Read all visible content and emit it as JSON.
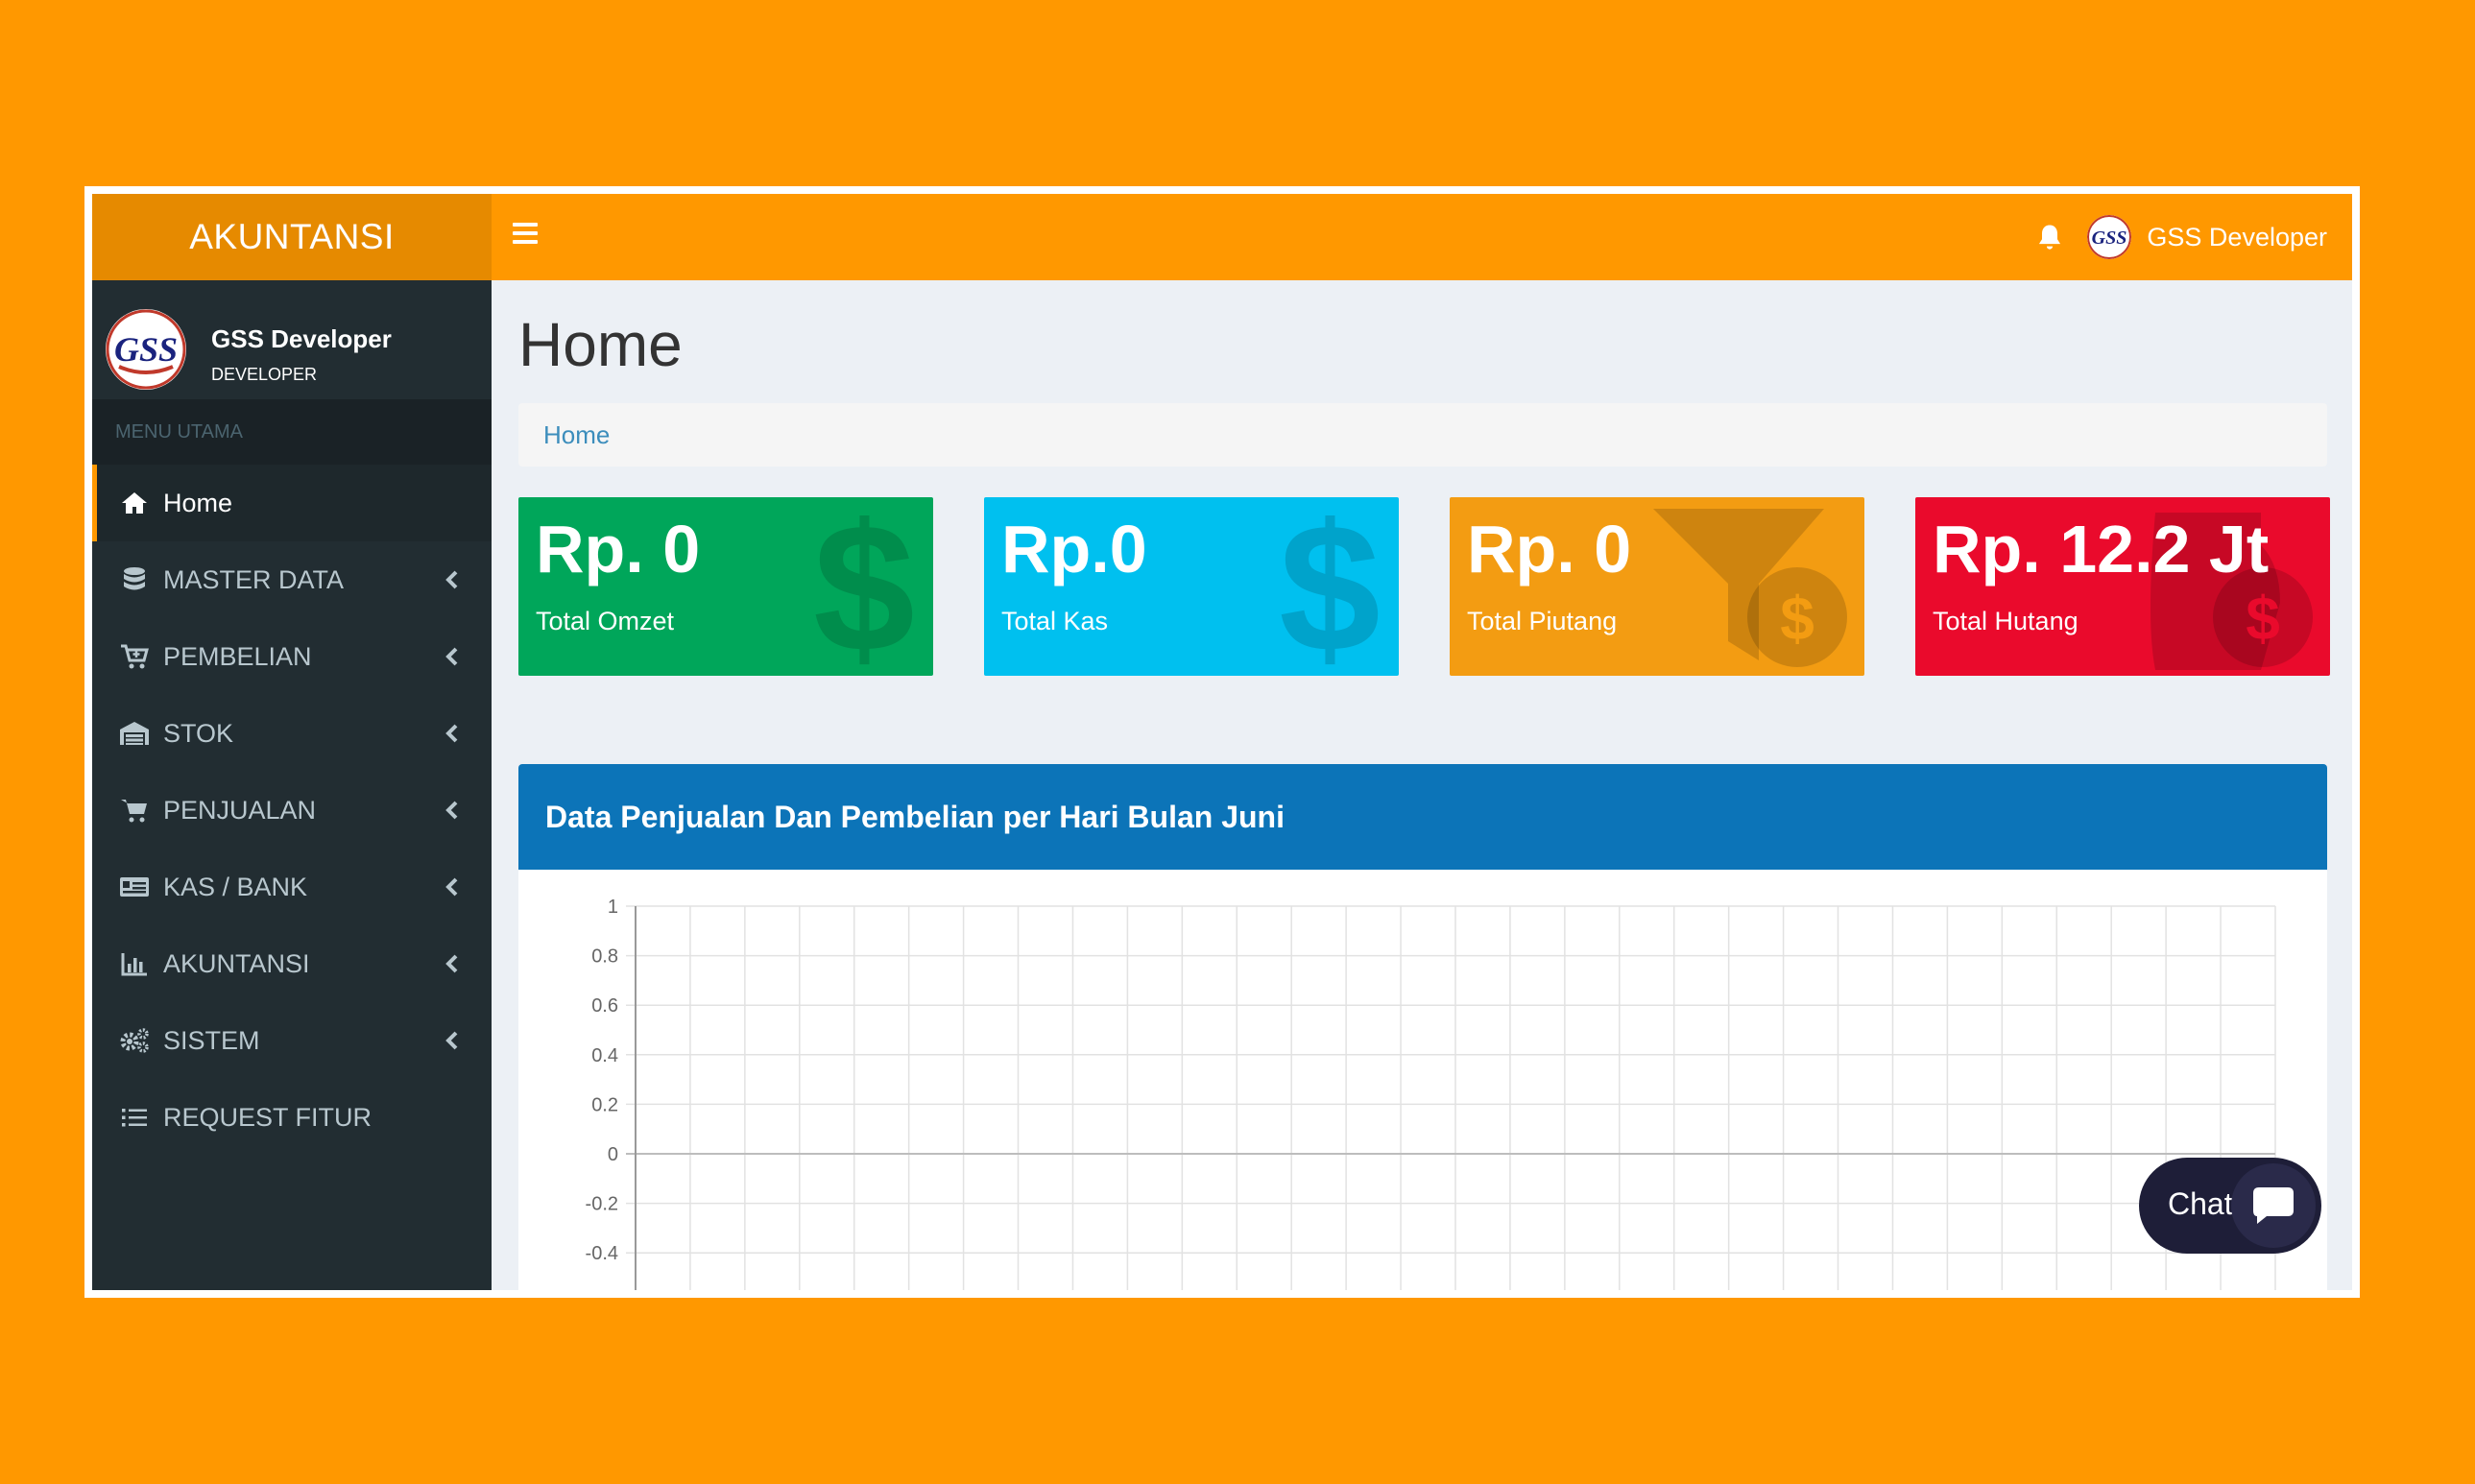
{
  "app": {
    "logo": "AKUNTANSI"
  },
  "navbar": {
    "user_name": "GSS Developer"
  },
  "sidebar": {
    "user_name": "GSS Developer",
    "user_role": "DEVELOPER",
    "menu_header": "MENU UTAMA",
    "items": [
      {
        "label": "Home",
        "icon": "home-icon",
        "active": true
      },
      {
        "label": "MASTER DATA",
        "icon": "database-icon"
      },
      {
        "label": "PEMBELIAN",
        "icon": "cart-plus-icon"
      },
      {
        "label": "STOK",
        "icon": "warehouse-icon"
      },
      {
        "label": "PENJUALAN",
        "icon": "cart-icon"
      },
      {
        "label": "KAS / BANK",
        "icon": "money-card-icon"
      },
      {
        "label": "AKUNTANSI",
        "icon": "bar-chart-icon"
      },
      {
        "label": "SISTEM",
        "icon": "gears-icon"
      },
      {
        "label": "REQUEST FITUR",
        "icon": "list-icon"
      }
    ]
  },
  "page": {
    "title": "Home",
    "breadcrumb": "Home"
  },
  "stats": [
    {
      "value": "Rp. 0",
      "label": "Total Omzet",
      "color": "#00a65a",
      "icon": "dollar-icon"
    },
    {
      "value": "Rp.0",
      "label": "Total Kas",
      "color": "#00c0ef",
      "icon": "dollar-icon"
    },
    {
      "value": "Rp. 0",
      "label": "Total Piutang",
      "color": "#f39c12",
      "icon": "funnel-dollar-icon"
    },
    {
      "value": "Rp. 12.2 Jt",
      "label": "Total Hutang",
      "color": "#ea0a2c",
      "icon": "hand-dollar-icon"
    }
  ],
  "panel": {
    "title": "Data Penjualan Dan Pembelian per Hari Bulan Juni"
  },
  "chart_data": {
    "type": "line",
    "title": "",
    "xlabel": "",
    "ylabel": "",
    "y_ticks": [
      "1",
      "0.8",
      "0.6",
      "0.4",
      "0.2",
      "0",
      "-0.2",
      "-0.4"
    ],
    "ylim": [
      -0.5,
      1
    ],
    "grid": true,
    "series": []
  },
  "chat": {
    "label": "Chat"
  }
}
